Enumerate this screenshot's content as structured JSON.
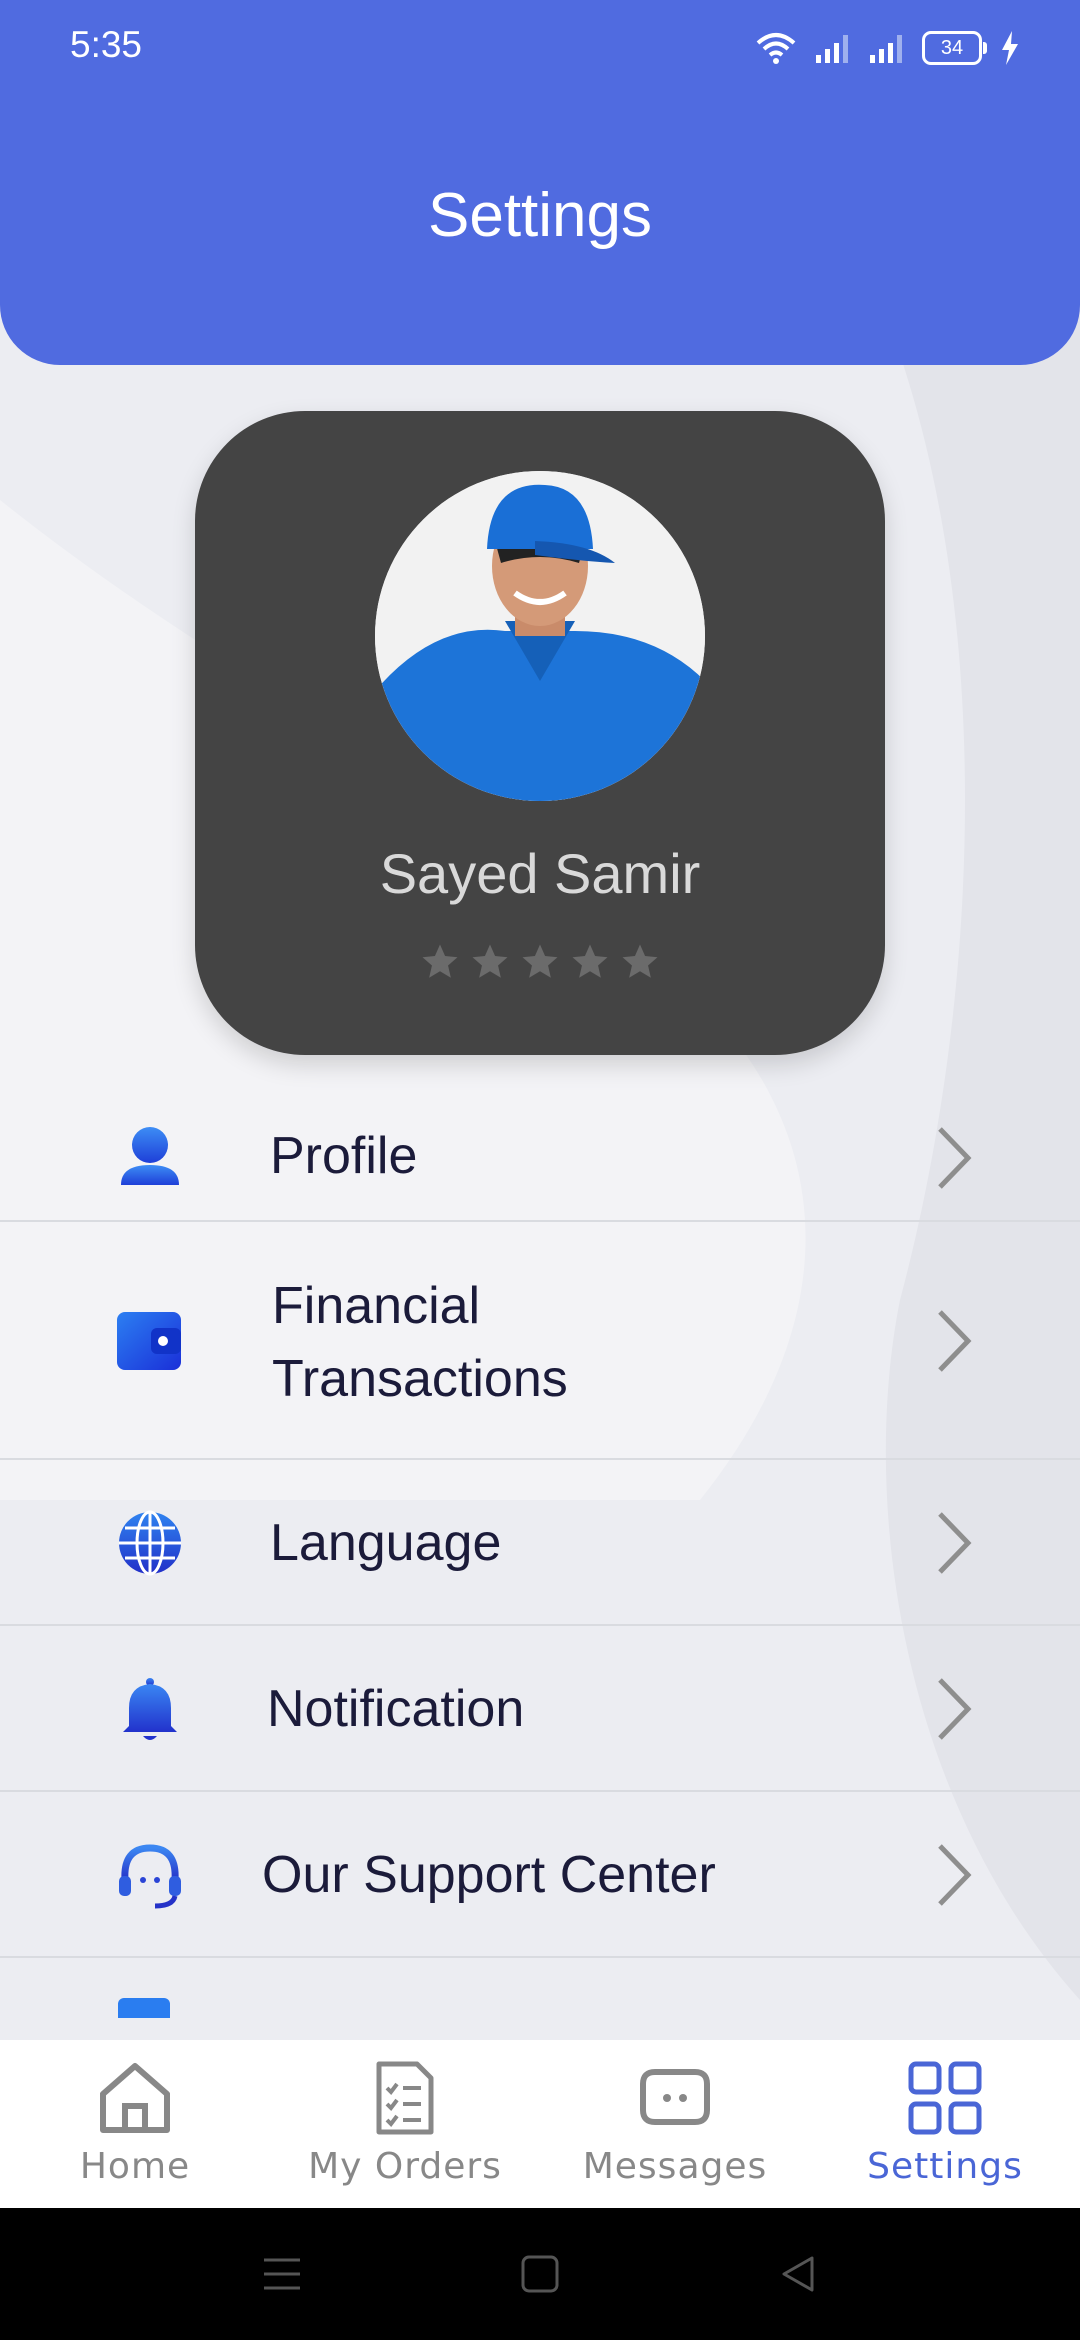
{
  "status_bar": {
    "time": "5:35",
    "battery": "34",
    "icons": [
      "wifi-icon",
      "signal-icon",
      "signal-icon",
      "battery-icon",
      "charging-icon"
    ]
  },
  "header": {
    "title": "Settings"
  },
  "profile": {
    "name": "Sayed Samir",
    "rating": 0,
    "rating_max": 5
  },
  "menu": {
    "items": [
      {
        "label": "Profile",
        "icon": "user-icon"
      },
      {
        "label": "Financial",
        "label_line2": "Transactions",
        "icon": "wallet-icon"
      },
      {
        "label": "Language",
        "icon": "globe-icon"
      },
      {
        "label": "Notification",
        "icon": "bell-icon"
      },
      {
        "label": "Our Support Center",
        "icon": "headset-icon"
      }
    ]
  },
  "bottom_nav": {
    "items": [
      {
        "label": "Home",
        "icon": "home-icon"
      },
      {
        "label": "My Orders",
        "icon": "orders-icon"
      },
      {
        "label": "Messages",
        "icon": "messages-icon"
      },
      {
        "label": "Settings",
        "icon": "grid-icon"
      }
    ],
    "active": "Settings"
  },
  "colors": {
    "header": "#506be0",
    "card": "#444444",
    "accent": "#4a66d6",
    "text": "#1b1b3a"
  }
}
